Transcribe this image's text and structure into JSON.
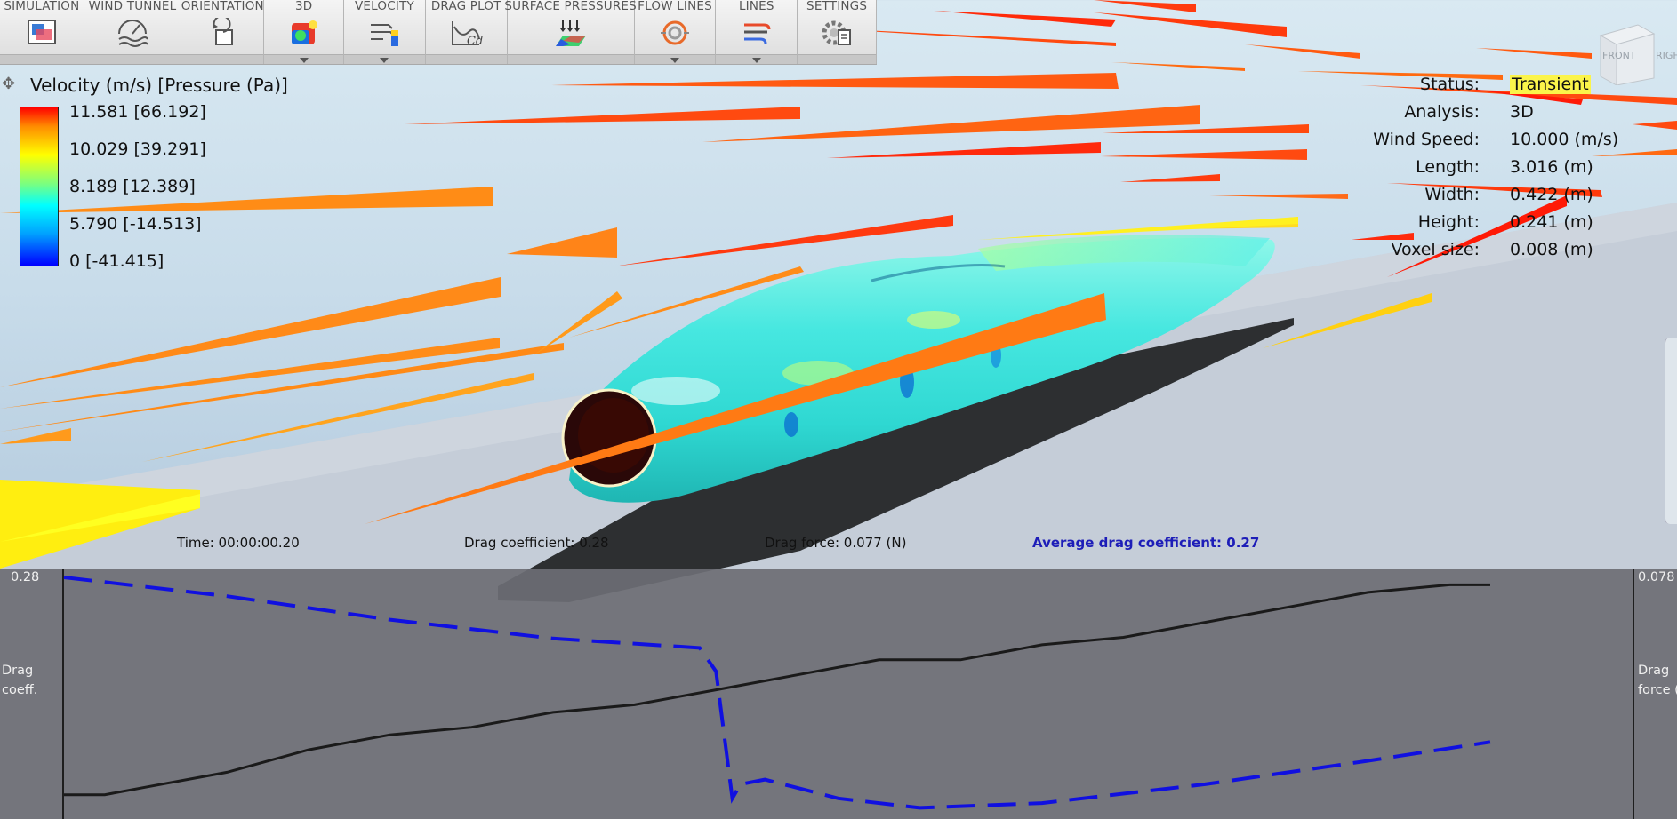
{
  "toolbar": {
    "groups": [
      {
        "label": "SIMULATION",
        "icon": "simulation-icon"
      },
      {
        "label": "WIND TUNNEL",
        "icon": "wind-tunnel-icon"
      },
      {
        "label": "ORIENTATION",
        "icon": "orientation-icon"
      },
      {
        "label": "3D",
        "icon": "3d-view-icon"
      },
      {
        "label": "VELOCITY",
        "icon": "velocity-icon"
      },
      {
        "label": "DRAG PLOT",
        "icon": "drag-plot-icon"
      },
      {
        "label": "SURFACE PRESSURES",
        "icon": "surface-pressures-icon"
      },
      {
        "label": "FLOW LINES",
        "icon": "flow-lines-icon"
      },
      {
        "label": "LINES",
        "icon": "lines-icon"
      },
      {
        "label": "SETTINGS",
        "icon": "settings-icon"
      }
    ]
  },
  "legend": {
    "title": "Velocity (m/s) [Pressure (Pa)]",
    "values": [
      "11.581 [66.192]",
      "10.029 [39.291]",
      "8.189 [12.389]",
      "5.790 [-14.513]",
      "0 [-41.415]"
    ],
    "gradient_colors": [
      "#ff0000",
      "#ff8c00",
      "#ffff00",
      "#7dff7d",
      "#00ffff",
      "#00a0ff",
      "#0000ff"
    ]
  },
  "status": {
    "status_label": "Status:",
    "status_value": "Transient",
    "analysis_label": "Analysis:",
    "analysis_value": "3D",
    "wind_label": "Wind Speed:",
    "wind_value": "10.000 (m/s)",
    "length_label": "Length:",
    "length_value": "3.016 (m)",
    "width_label": "Width:",
    "width_value": "0.422 (m)",
    "height_label": "Height:",
    "height_value": "0.241 (m)",
    "voxel_label": "Voxel size:",
    "voxel_value": "0.008 (m)"
  },
  "view_cube": {
    "front_label": "FRONT",
    "right_label": "RIGH"
  },
  "info": {
    "time": "Time: 00:00:00.20",
    "drag_coefficient": "Drag coefficient: 0.28",
    "drag_force": "Drag force: 0.077 (N)",
    "average_drag": "Average drag coefficient: 0.27"
  },
  "plot": {
    "left_max": "0.28",
    "right_max": "0.078",
    "left_axis_label": "Drag\ncoeff.",
    "right_axis_label": "Drag\nforce (",
    "colors": {
      "drag_coeff_series": "#1010e0",
      "drag_force_series": "#1a1a1a"
    }
  },
  "chart_data": {
    "type": "line",
    "title": "",
    "xlabel": "",
    "series": [
      {
        "axis": "left",
        "style": "dashed",
        "x": [
          0.0,
          0.2,
          0.4,
          0.6,
          0.78,
          0.8,
          0.82,
          0.83,
          0.86,
          0.95,
          1.05,
          1.2,
          1.4,
          1.6,
          1.75
        ],
        "y": [
          0.28,
          0.276,
          0.271,
          0.267,
          0.265,
          0.26,
          0.233,
          0.236,
          0.237,
          0.233,
          0.231,
          0.232,
          0.236,
          0.241,
          0.245
        ]
      },
      {
        "axis": "right",
        "style": "solid",
        "x": [
          0.0,
          0.05,
          0.1,
          0.2,
          0.3,
          0.4,
          0.5,
          0.6,
          0.7,
          0.8,
          0.9,
          1.0,
          1.1,
          1.2,
          1.3,
          1.4,
          1.5,
          1.6,
          1.7,
          1.75
        ],
        "y": [
          0.049,
          0.049,
          0.05,
          0.052,
          0.055,
          0.057,
          0.058,
          0.06,
          0.061,
          0.063,
          0.065,
          0.067,
          0.067,
          0.069,
          0.07,
          0.072,
          0.074,
          0.076,
          0.077,
          0.077
        ]
      }
    ]
  }
}
